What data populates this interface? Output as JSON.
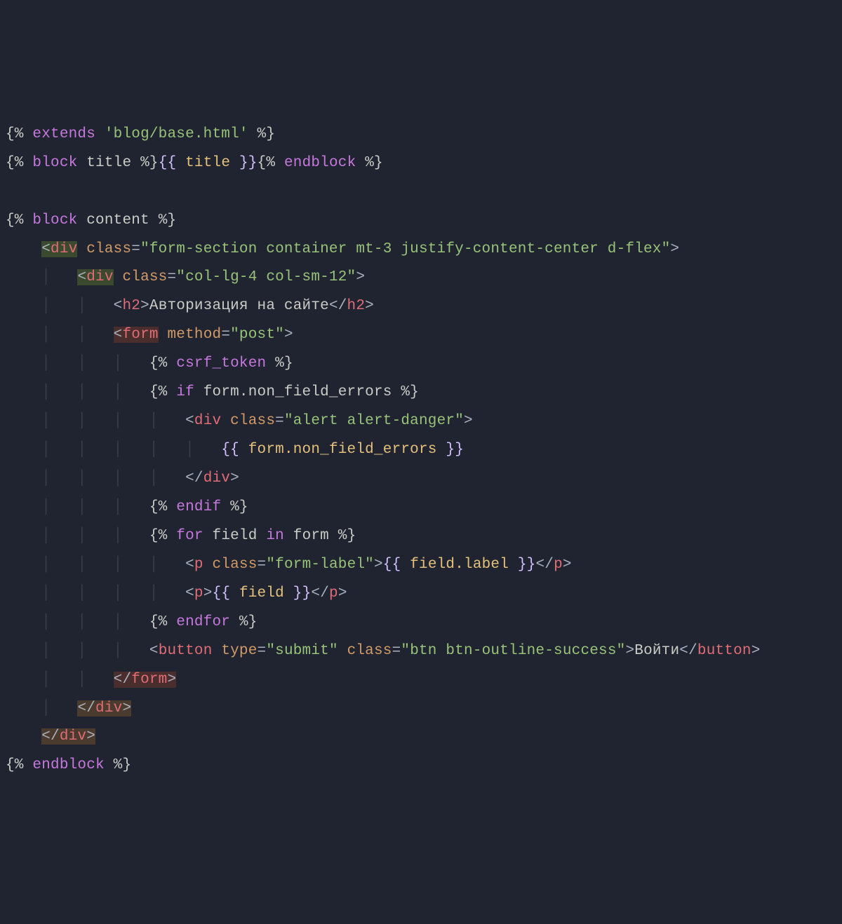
{
  "line1": {
    "open": "{%",
    "kw": "extends",
    "str": "'blog/base.html'",
    "close": "%}"
  },
  "line2": {
    "open1": "{%",
    "kw1": "block",
    "name": "title",
    "close1": "%}",
    "varopen": "{{",
    "var": "title",
    "varclose": "}}",
    "open2": "{%",
    "kw2": "endblock",
    "close2": "%}"
  },
  "line4": {
    "open": "{%",
    "kw": "block",
    "name": "content",
    "close": "%}"
  },
  "line5": {
    "lt": "<",
    "tag": "div",
    "attr": "class",
    "eq": "=",
    "val": "\"form-section container mt-3 justify-content-center d-flex\"",
    "gt": ">"
  },
  "line6": {
    "lt": "<",
    "tag": "div",
    "attr": "class",
    "eq": "=",
    "val": "\"col-lg-4 col-sm-12\"",
    "gt": ">"
  },
  "line7": {
    "lt1": "<",
    "tag1": "h2",
    "gt1": ">",
    "text": "Авторизация на сайте",
    "lt2": "</",
    "tag2": "h2",
    "gt2": ">"
  },
  "line8": {
    "lt": "<",
    "tag": "form",
    "attr": "method",
    "eq": "=",
    "val": "\"post\"",
    "gt": ">"
  },
  "line9": {
    "open": "{%",
    "kw": "csrf_token",
    "close": "%}"
  },
  "line10": {
    "open": "{%",
    "kw": "if",
    "expr": "form.non_field_errors",
    "close": "%}"
  },
  "line11": {
    "lt": "<",
    "tag": "div",
    "attr": "class",
    "eq": "=",
    "val": "\"alert alert-danger\"",
    "gt": ">"
  },
  "line12": {
    "open": "{{",
    "expr": "form.non_field_errors",
    "close": "}}"
  },
  "line13": {
    "lt": "</",
    "tag": "div",
    "gt": ">"
  },
  "line14": {
    "open": "{%",
    "kw": "endif",
    "close": "%}"
  },
  "line15": {
    "open": "{%",
    "kw1": "for",
    "var": "field",
    "kw2": "in",
    "iter": "form",
    "close": "%}"
  },
  "line16": {
    "lt1": "<",
    "tag1": "p",
    "attr": "class",
    "eq": "=",
    "val": "\"form-label\"",
    "gt1": ">",
    "varopen": "{{",
    "expr": "field.label",
    "varclose": "}}",
    "lt2": "</",
    "tag2": "p",
    "gt2": ">"
  },
  "line17": {
    "lt1": "<",
    "tag1": "p",
    "gt1": ">",
    "varopen": "{{",
    "expr": "field",
    "varclose": "}}",
    "lt2": "</",
    "tag2": "p",
    "gt2": ">"
  },
  "line18": {
    "open": "{%",
    "kw": "endfor",
    "close": "%}"
  },
  "line19": {
    "lt1": "<",
    "tag1": "button",
    "attr1": "type",
    "eq1": "=",
    "val1": "\"submit\"",
    "attr2": "class",
    "eq2": "=",
    "val2": "\"btn btn-outline-success\"",
    "gt1": ">",
    "text": "Войти",
    "lt2": "</",
    "tag2": "button",
    "gt2": ">"
  },
  "line20": {
    "lt": "</",
    "tag": "form",
    "gt": ">"
  },
  "line21": {
    "lt": "</",
    "tag": "div",
    "gt": ">"
  },
  "line22": {
    "lt": "</",
    "tag": "div",
    "gt": ">"
  },
  "line23": {
    "open": "{%",
    "kw": "endblock",
    "close": "%}"
  },
  "guide": "│"
}
